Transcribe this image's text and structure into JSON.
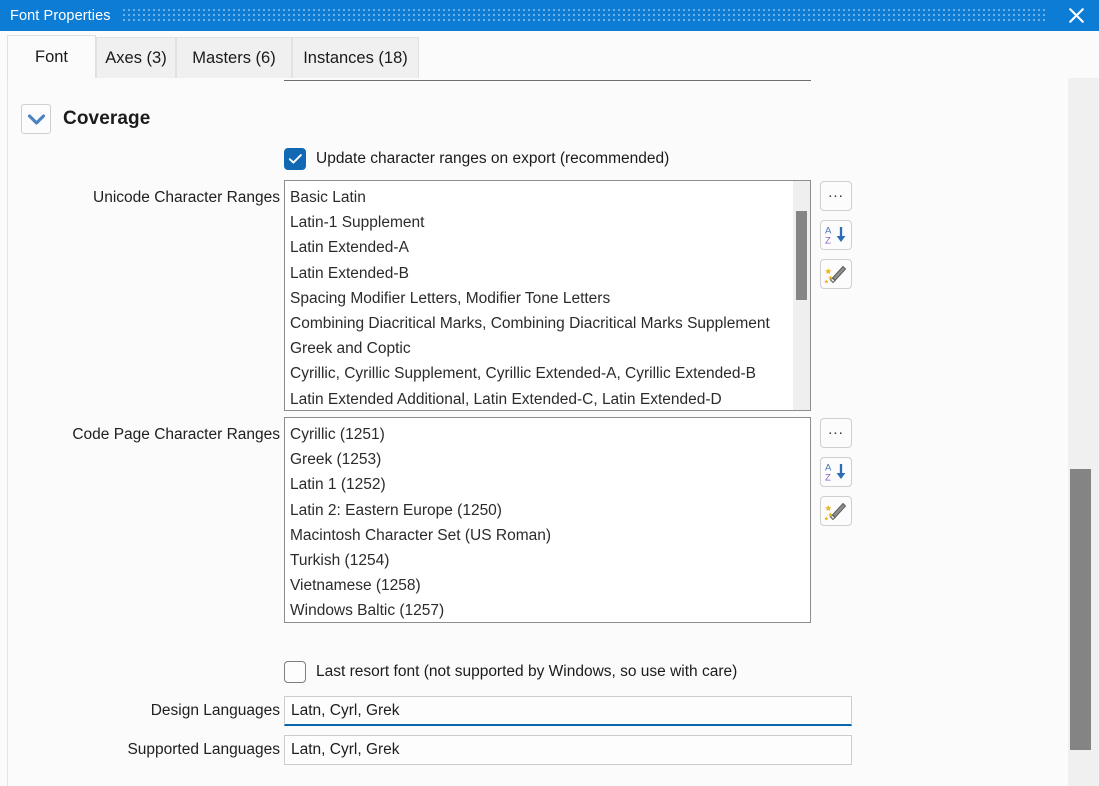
{
  "window": {
    "title": "Font Properties",
    "close_icon": "close-icon",
    "accent_color": "#0d7cd5"
  },
  "tabs": [
    {
      "label": "Font",
      "active": true
    },
    {
      "label": "Axes (3)",
      "active": false
    },
    {
      "label": "Masters (6)",
      "active": false
    },
    {
      "label": "Instances (18)",
      "active": false
    }
  ],
  "coverage": {
    "title": "Coverage",
    "toggle_icon": "chevron-down-icon",
    "update_ranges": {
      "label": "Update character ranges on export (recommended)",
      "checked": true
    },
    "unicode_ranges": {
      "label": "Unicode Character Ranges",
      "items": [
        "Basic Latin",
        "Latin-1 Supplement",
        "Latin Extended-A",
        "Latin Extended-B",
        "Spacing Modifier Letters, Modifier Tone Letters",
        "Combining Diacritical Marks, Combining Diacritical Marks Supplement",
        "Greek and Coptic",
        "Cyrillic, Cyrillic Supplement, Cyrillic Extended-A, Cyrillic Extended-B",
        "Latin Extended Additional, Latin Extended-C, Latin Extended-D"
      ]
    },
    "codepage_ranges": {
      "label": "Code Page Character Ranges",
      "items": [
        "Cyrillic (1251)",
        "Greek (1253)",
        "Latin 1 (1252)",
        "Latin 2: Eastern Europe (1250)",
        "Macintosh Character Set (US Roman)",
        "Turkish (1254)",
        "Vietnamese (1258)",
        "Windows Baltic (1257)"
      ]
    },
    "side_buttons": [
      {
        "name": "ellipsis",
        "label": "...",
        "icon": "ellipsis-icon"
      },
      {
        "name": "sort",
        "label": "",
        "icon": "sort-az-descending-icon"
      },
      {
        "name": "auto",
        "label": "",
        "icon": "magic-wand-icon"
      }
    ],
    "last_resort": {
      "label": "Last resort font (not supported by Windows, so use with care)",
      "checked": false
    },
    "design_languages": {
      "label": "Design Languages",
      "value": "Latn, Cyrl, Grek",
      "placeholder": "",
      "focused": true
    },
    "supported_languages": {
      "label": "Supported Languages",
      "value": "Latn, Cyrl, Grek",
      "placeholder": "",
      "focused": false
    }
  },
  "scrollbars": {
    "main_vertical": {
      "position_percent": 56
    },
    "unicode_list": {
      "position_percent": 15
    }
  }
}
